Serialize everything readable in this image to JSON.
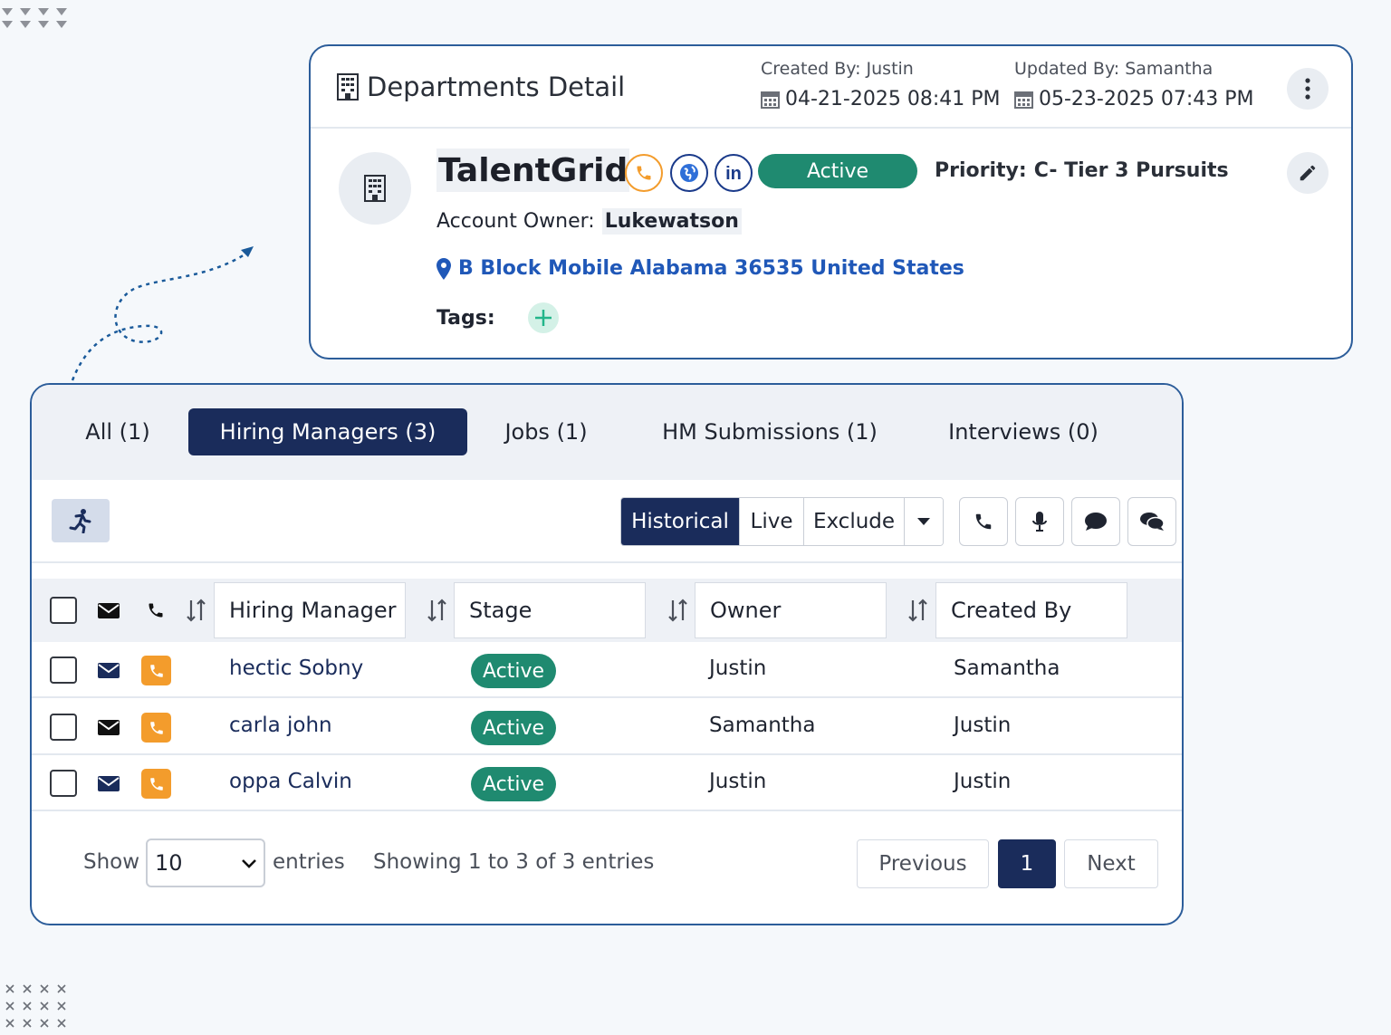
{
  "detail": {
    "title": "Departments Detail",
    "created_by_label": "Created By:",
    "created_by": "Justin",
    "created_date": "04-21-2025 08:41 PM",
    "updated_by_label": "Updated By:",
    "updated_by": "Samantha",
    "updated_date": "05-23-2025 07:43 PM",
    "company_name": "TalentGrid",
    "status": "Active",
    "priority_label": "Priority:",
    "priority_value": "C- Tier 3 Pursuits",
    "owner_label": "Account Owner:",
    "owner_value": "Lukewatson",
    "address": "B Block Mobile Alabama 36535 United States",
    "tags_label": "Tags:",
    "contact_icons": [
      "phone-icon",
      "globe-icon",
      "linkedin-icon"
    ],
    "colors": {
      "accent": "#1a2c5b",
      "status_green": "#1f8a70",
      "phone_orange": "#f39c2c",
      "link_blue": "#2058b8",
      "card_border": "#2c5d9a"
    }
  },
  "tabs": [
    {
      "label": "All (1)",
      "active": false
    },
    {
      "label": "Hiring Managers (3)",
      "active": true
    },
    {
      "label": "Jobs (1)",
      "active": false
    },
    {
      "label": "HM Submissions (1)",
      "active": false
    },
    {
      "label": "Interviews (0)",
      "active": false
    }
  ],
  "toolbar": {
    "modes": [
      "Historical",
      "Live",
      "Exclude"
    ],
    "selected_mode": "Historical",
    "icons": [
      "runner-icon",
      "phone-icon",
      "microphone-icon",
      "chat-icon",
      "comments-icon"
    ]
  },
  "table": {
    "columns": [
      "Hiring Manager",
      "Stage",
      "Owner",
      "Created By"
    ],
    "rows": [
      {
        "name": "hectic Sobny",
        "stage": "Active",
        "owner": "Justin",
        "created_by": "Samantha"
      },
      {
        "name": "carla john",
        "stage": "Active",
        "owner": "Samantha",
        "created_by": "Justin"
      },
      {
        "name": "oppa Calvin",
        "stage": "Active",
        "owner": "Justin",
        "created_by": "Justin"
      }
    ]
  },
  "footer": {
    "show_label": "Show",
    "page_size": "10",
    "entries_label": "entries",
    "showing_text": "Showing 1 to 3 of 3 entries",
    "previous_label": "Previous",
    "current_page": "1",
    "next_label": "Next"
  }
}
